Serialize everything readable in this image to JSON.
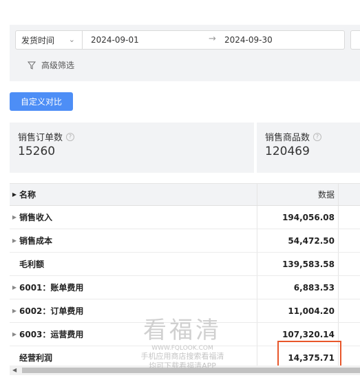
{
  "filters": {
    "date_type": "发货时间",
    "start_date": "2024-09-01",
    "end_date": "2024-09-30",
    "advanced_filter_label": "高级筛选"
  },
  "buttons": {
    "compare_label": "自定义对比"
  },
  "metrics": [
    {
      "label": "销售订单数",
      "value": "15260"
    },
    {
      "label": "销售商品数",
      "value": "120469"
    }
  ],
  "table": {
    "headers": {
      "name": "名称",
      "value": "数据"
    },
    "rows": [
      {
        "name": "销售收入",
        "value": "194,056.08",
        "expandable": true
      },
      {
        "name": "销售成本",
        "value": "54,472.50",
        "expandable": true
      },
      {
        "name": "毛利额",
        "value": "139,583.58",
        "expandable": false
      },
      {
        "name": "6001：账单费用",
        "value": "6,883.53",
        "expandable": true
      },
      {
        "name": "6002：订单费用",
        "value": "11,004.20",
        "expandable": true
      },
      {
        "name": "6003：运营费用",
        "value": "107,320.14",
        "expandable": true
      },
      {
        "name": "经营利润",
        "value": "14,375.71",
        "expandable": false
      }
    ]
  },
  "watermark": {
    "title": "看福清",
    "url": "WWW.FQLOOK.COM",
    "line1": "手机应用商店搜索看福清",
    "line2": "均可下载看福清APP"
  },
  "colors": {
    "primary_button": "#4d8ef6",
    "highlight_border": "#e8562a",
    "panel_bg": "#f2f3f5"
  }
}
